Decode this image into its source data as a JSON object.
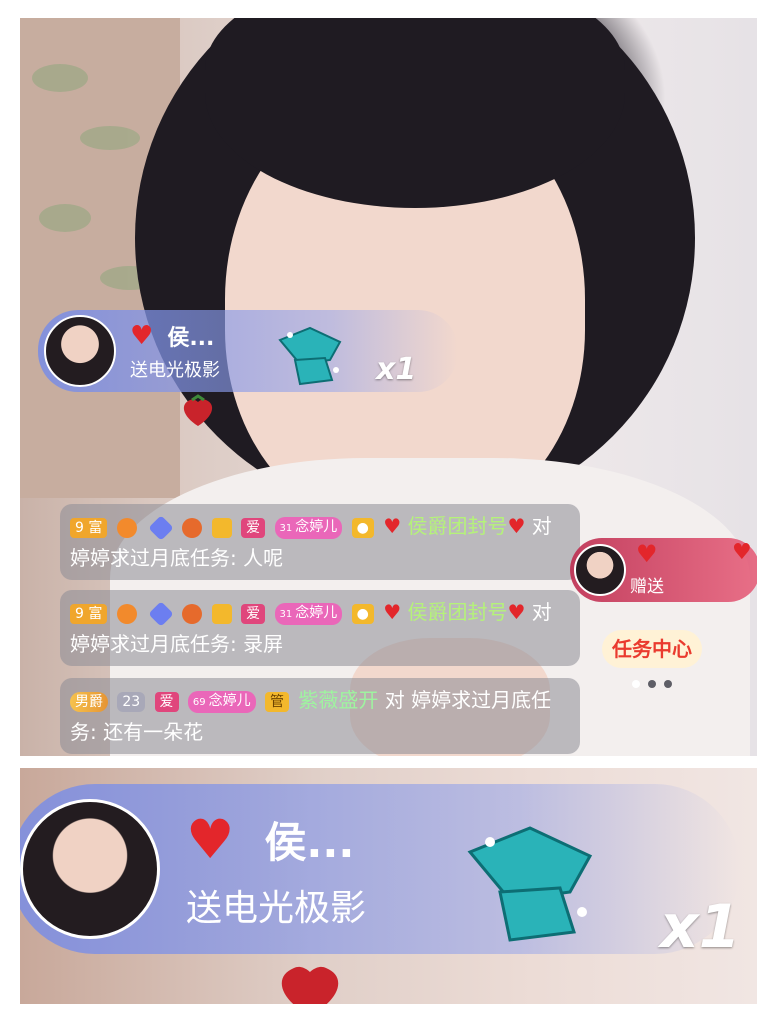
{
  "gift_banner": {
    "sender_name": "侯...",
    "gift_action": "送电光极影",
    "multiplier": "x1"
  },
  "chat_messages": [
    {
      "rich_badge": "9 富",
      "love_badge": "爱",
      "fan_badge": "念婷儿",
      "fan_level": "31",
      "user": "侯爵团封号",
      "connector": "对",
      "target": "婷婷求过月底任务",
      "colon": ":",
      "content": "人呢"
    },
    {
      "rich_badge": "9 富",
      "love_badge": "爱",
      "fan_badge": "念婷儿",
      "fan_level": "31",
      "user": "侯爵团封号",
      "connector": "对",
      "target": "婷婷求过月底任务",
      "colon": ":",
      "content": "录屏"
    },
    {
      "noble_badge": "男爵",
      "shield_level": "23",
      "love_badge": "爱",
      "fan_badge": "念婷儿",
      "fan_level": "69",
      "admin_badge": "管",
      "user": "紫薇盛开",
      "connector": "对",
      "target": "婷婷求过月底任务",
      "colon": ":",
      "content": "还有一朵花"
    }
  ],
  "side_widget": {
    "action": "赠送",
    "task_center": "任务中心"
  },
  "zoom_banner": {
    "sender_name": "侯...",
    "gift_action": "送电光极影",
    "multiplier": "x1"
  },
  "colors": {
    "heart": "#e3262b",
    "banner": "#7d8ce6",
    "task_center_text": "#ea3a2e"
  }
}
